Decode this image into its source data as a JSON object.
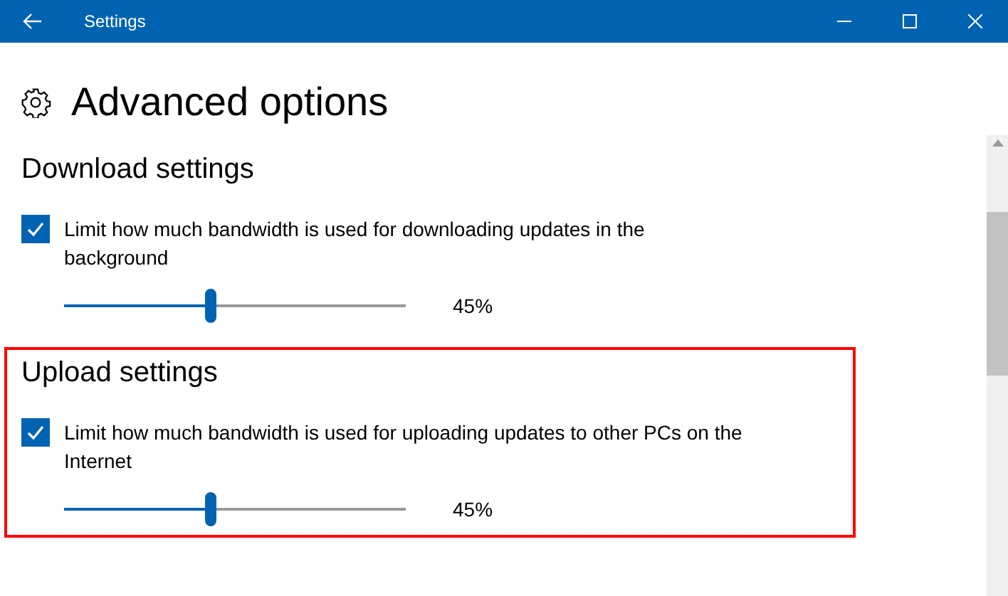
{
  "window": {
    "title": "Settings"
  },
  "page": {
    "title": "Advanced options"
  },
  "sections": [
    {
      "heading": "Download settings",
      "highlighted": false,
      "checked": true,
      "label": "Limit how much bandwidth is used for downloading updates in the background",
      "level": 0.43,
      "reading": "45%"
    },
    {
      "heading": "Upload settings",
      "highlighted": true,
      "checked": true,
      "label": "Limit how much bandwidth is used for uploading updates to other PCs on the Internet",
      "level": 0.43,
      "reading": "45%"
    }
  ]
}
